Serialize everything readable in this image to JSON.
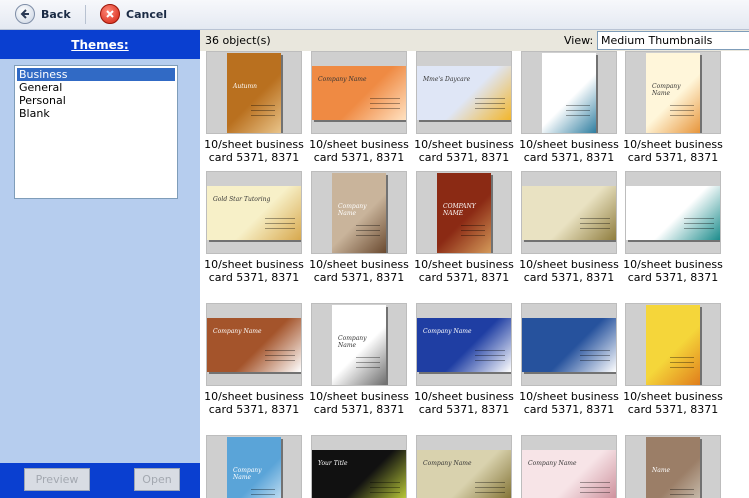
{
  "toolbar": {
    "back_label": "Back",
    "cancel_label": "Cancel"
  },
  "themes": {
    "header": "Themes:",
    "items": [
      "Business",
      "General",
      "Personal",
      "Blank"
    ],
    "selected_index": 0
  },
  "footer": {
    "preview_label": "Preview",
    "open_label": "Open"
  },
  "gallery": {
    "count_label": "36 object(s)",
    "view_label": "View:",
    "view_value": "Medium Thumbnails",
    "caption_line1": "10/sheet business",
    "caption_line2": "card 5371, 8371"
  },
  "thumbnails": [
    {
      "orient": "v",
      "bg": "#b9701f",
      "accent": "#e9c48a",
      "title": "Autumn"
    },
    {
      "orient": "h",
      "bg": "#ef8a43",
      "accent": "#ffe2c2",
      "title": "Company Name"
    },
    {
      "orient": "h",
      "bg": "#dfe6f6",
      "accent": "#f2b62c",
      "title": "Mme's Daycare"
    },
    {
      "orient": "v",
      "bg": "#ffffff",
      "accent": "#2f7ea0",
      "title": ""
    },
    {
      "orient": "v",
      "bg": "#fff6da",
      "accent": "#e7953b",
      "title": "Company Name"
    },
    {
      "orient": "h",
      "bg": "#f7f0c8",
      "accent": "#d7a84e",
      "title": "Gold Star Tutoring"
    },
    {
      "orient": "v",
      "bg": "#c9b49b",
      "accent": "#6a4a30",
      "title": "Company Name"
    },
    {
      "orient": "v",
      "bg": "#8b2a14",
      "accent": "#d49a5a",
      "title": "COMPANY NAME"
    },
    {
      "orient": "h",
      "bg": "#e9e2c2",
      "accent": "#8f7d3e",
      "title": ""
    },
    {
      "orient": "h",
      "bg": "#ffffff",
      "accent": "#1c8c8c",
      "title": ""
    },
    {
      "orient": "h",
      "bg": "#a4542b",
      "accent": "#ffffff",
      "title": "Company Name"
    },
    {
      "orient": "v",
      "bg": "#ffffff",
      "accent": "#6d6d6d",
      "title": "Company Name"
    },
    {
      "orient": "h",
      "bg": "#1f3ea3",
      "accent": "#ffffff",
      "title": "Company Name"
    },
    {
      "orient": "h",
      "bg": "#26529d",
      "accent": "#ffffff",
      "title": ""
    },
    {
      "orient": "v",
      "bg": "#f5d63a",
      "accent": "#e07d1c",
      "title": ""
    },
    {
      "orient": "v",
      "bg": "#5aa4d8",
      "accent": "#eaf4fb",
      "title": "Company Name"
    },
    {
      "orient": "h",
      "bg": "#111111",
      "accent": "#c8d93c",
      "title": "Your Title"
    },
    {
      "orient": "h",
      "bg": "#d9d2ae",
      "accent": "#7b6b2b",
      "title": "Company Name"
    },
    {
      "orient": "h",
      "bg": "#f7e4e7",
      "accent": "#c98a96",
      "title": "Company Name"
    },
    {
      "orient": "v",
      "bg": "#9b7e67",
      "accent": "#d8d4c8",
      "title": "Name"
    }
  ]
}
